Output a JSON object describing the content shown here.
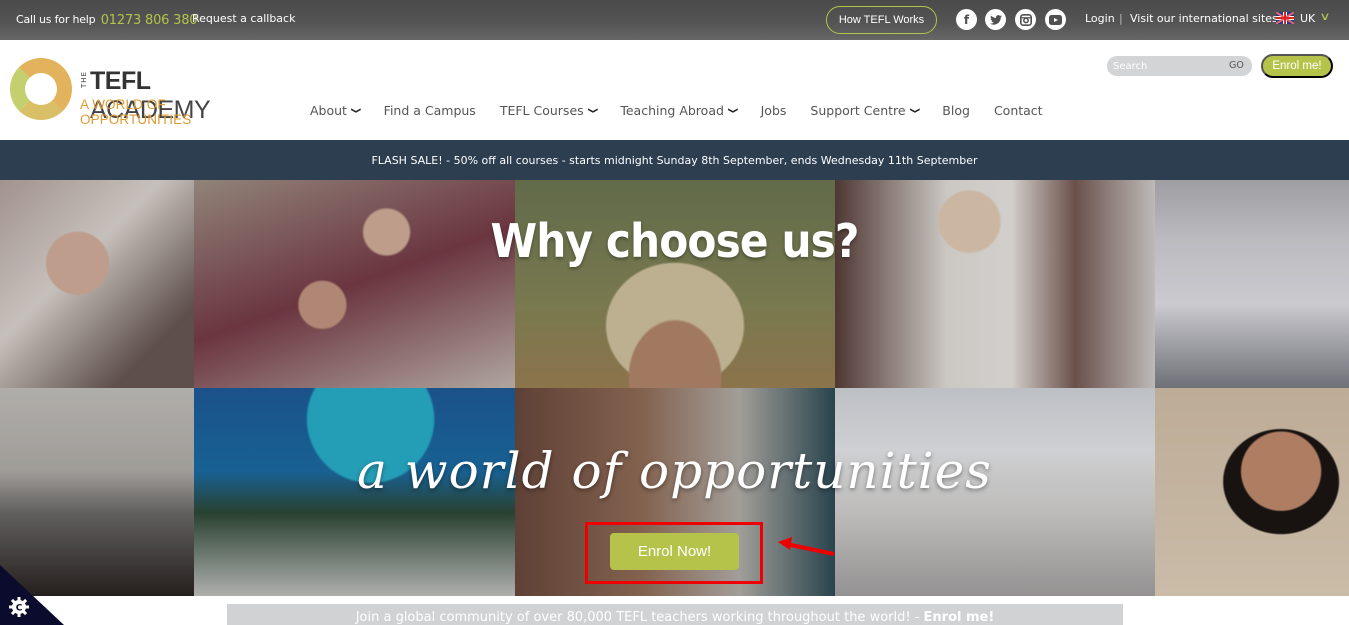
{
  "topbar": {
    "help_label": "Call us for help",
    "phone": "01273 806 380",
    "callback": "Request a callback",
    "how_tefl_works": "How TEFL Works",
    "social": [
      {
        "name": "facebook-icon",
        "glyph": "f"
      },
      {
        "name": "twitter-icon",
        "glyph": "t"
      },
      {
        "name": "instagram-icon",
        "glyph": "◙"
      },
      {
        "name": "youtube-icon",
        "glyph": "▶"
      }
    ],
    "login": "Login",
    "separator": "|",
    "international": "Visit our international sites",
    "region": "UK",
    "region_chevron": "∨"
  },
  "logo": {
    "the": "THE",
    "title_bold": "TEFL",
    "title_rest": " ACADEMY",
    "tagline": "A WORLD OF OPPORTUNITIES"
  },
  "nav": [
    {
      "label": "About",
      "dropdown": true
    },
    {
      "label": "Find a Campus",
      "dropdown": false
    },
    {
      "label": "TEFL Courses",
      "dropdown": true
    },
    {
      "label": "Teaching Abroad",
      "dropdown": true
    },
    {
      "label": "Jobs",
      "dropdown": false
    },
    {
      "label": "Support Centre",
      "dropdown": true
    },
    {
      "label": "Blog",
      "dropdown": false
    },
    {
      "label": "Contact",
      "dropdown": false
    }
  ],
  "nav_chevron": "⌄",
  "search": {
    "placeholder": "Search",
    "value": "",
    "go": "GO"
  },
  "enrol_me": "Enrol me!",
  "flash_banner": "FLASH SALE! - 50% off all courses - starts midnight Sunday 8th September, ends Wednesday 11th September",
  "hero": {
    "heading": "Why choose us?",
    "tagline": "a world of opportunities",
    "cta": "Enrol Now!"
  },
  "join": {
    "text": "Join a global community of over 80,000 TEFL teachers working throughout the world! - ",
    "link": "Enrol me!"
  },
  "colors": {
    "accent_green": "#b5c34a",
    "brand_orange": "#e09a32",
    "banner_navy": "#2c3e50",
    "highlight_red": "#ee0000"
  }
}
